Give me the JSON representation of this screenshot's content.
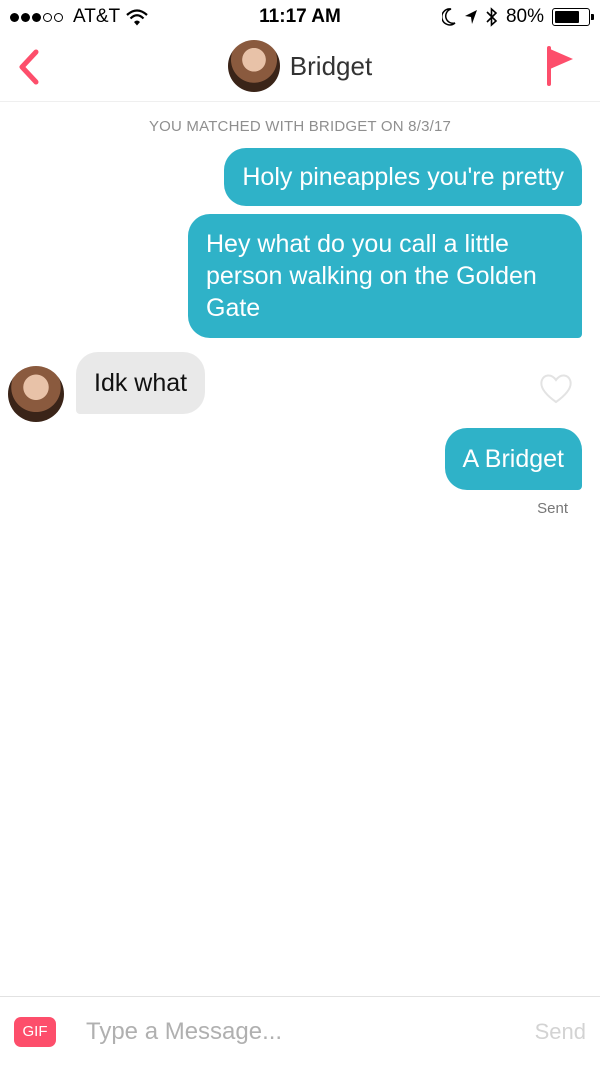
{
  "status_bar": {
    "carrier": "AT&T",
    "time": "11:17 AM",
    "battery_percent": "80%",
    "battery_level": 0.8,
    "icons": [
      "signal-dots-icon",
      "wifi-icon",
      "moon-icon",
      "location-arrow-icon",
      "bluetooth-icon",
      "battery-icon"
    ]
  },
  "header": {
    "match_name": "Bridget",
    "back_icon": "chevron-left-icon",
    "report_icon": "flag-icon",
    "accent_color": "#fd4e6b"
  },
  "chat": {
    "match_note": "YOU MATCHED WITH BRIDGET ON 8/3/17",
    "messages": [
      {
        "from": "me",
        "text": "Holy pineapples you're pretty"
      },
      {
        "from": "me",
        "text": "Hey what do you call a little person walking on the Golden Gate"
      },
      {
        "from": "them",
        "text": "Idk what"
      },
      {
        "from": "me",
        "text": "A Bridget"
      }
    ],
    "sent_status": "Sent",
    "outgoing_color": "#2fb2c8",
    "incoming_color": "#e9e9e9"
  },
  "composer": {
    "gif_label": "GIF",
    "placeholder": "Type a Message...",
    "value": "",
    "send_label": "Send"
  }
}
